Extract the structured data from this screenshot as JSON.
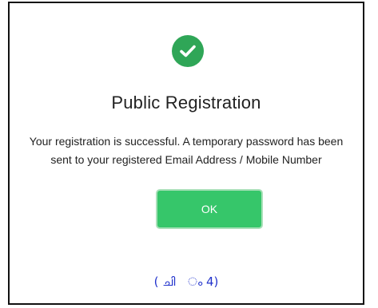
{
  "dialog": {
    "icon": "check-circle-icon",
    "title": "Public Registration",
    "message": "Your registration is successful. A temporary password has been sent to your registered Email Address / Mobile Number",
    "ok_label": "OK"
  },
  "footer": {
    "text": "( ചി   ം 4)"
  },
  "colors": {
    "success_green": "#2fa657",
    "button_green": "#36c66a",
    "footer_blue": "#2233cc"
  }
}
